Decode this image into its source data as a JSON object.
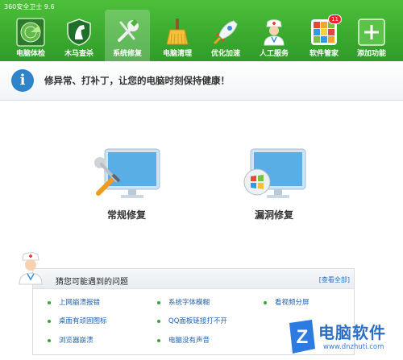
{
  "app": {
    "title": "360安全卫士 9.6"
  },
  "tabs": [
    {
      "label": "电脑体检",
      "icon": "radar-icon"
    },
    {
      "label": "木马查杀",
      "icon": "horse-shield-icon"
    },
    {
      "label": "系统修复",
      "icon": "wrench-icon",
      "active": true
    },
    {
      "label": "电脑清理",
      "icon": "broom-icon"
    },
    {
      "label": "优化加速",
      "icon": "rocket-icon"
    },
    {
      "label": "人工服务",
      "icon": "doctor-icon"
    },
    {
      "label": "软件管家",
      "icon": "apps-grid-icon",
      "badge": "11"
    },
    {
      "label": "添加功能",
      "icon": "plus-icon"
    }
  ],
  "info": {
    "text": "修异常、打补丁，让您的电脑时刻保持健康！"
  },
  "options": {
    "normal_repair": "常规修复",
    "vulnerability_repair": "漏洞修复"
  },
  "issues": {
    "title": "猜您可能遇到的问题",
    "view_all": "[查看全部]",
    "items": [
      "上网崩溃报错",
      "系统字体模糊",
      "看视频分屏",
      "桌面有顽固图标",
      "QQ面板链接打不开",
      "浏览器崩溃",
      "电脑没有声音"
    ]
  },
  "watermark": {
    "title": "电脑软件",
    "url": "www.dnzhuti.com",
    "letter": "Z"
  },
  "colors": {
    "header": "#3aaf30",
    "accent": "#2f84c9",
    "link": "#2060b0"
  }
}
